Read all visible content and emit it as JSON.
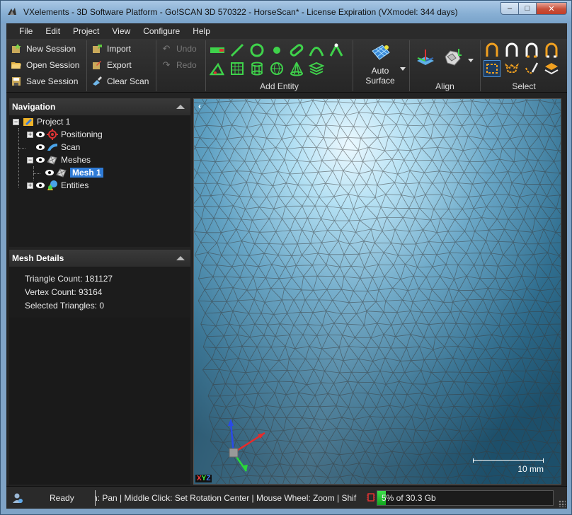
{
  "window": {
    "title": "VXelements - 3D Software Platform - Go!SCAN 3D 570322 - HorseScan* - License Expiration (VXmodel: 344 days)",
    "controls": {
      "minimize": "–",
      "maximize": "□",
      "close": "✕"
    }
  },
  "menu": [
    "File",
    "Edit",
    "Project",
    "View",
    "Configure",
    "Help"
  ],
  "ribbon": {
    "session": {
      "new": "New Session",
      "open": "Open Session",
      "save": "Save Session"
    },
    "io": {
      "import": "Import",
      "export": "Export",
      "clear": "Clear Scan"
    },
    "history": {
      "undo": "Undo",
      "redo": "Redo"
    },
    "add_entity": {
      "title": "Add Entity"
    },
    "auto_surface": {
      "line1": "Auto",
      "line2": "Surface"
    },
    "align": {
      "title": "Align"
    },
    "select": {
      "title": "Select"
    }
  },
  "navigation": {
    "title": "Navigation",
    "project": "Project 1",
    "positioning": "Positioning",
    "scan": "Scan",
    "meshes": "Meshes",
    "mesh": "Mesh 1",
    "entities": "Entities"
  },
  "mesh_details": {
    "title": "Mesh Details",
    "triangle_count": "Triangle Count: 181127",
    "vertex_count": "Vertex Count: 93164",
    "selected": "Selected Triangles: 0"
  },
  "viewport": {
    "collapse": "‹",
    "scale_label": "10 mm",
    "axes": {
      "x": "X",
      "y": "Y",
      "z": "Z"
    }
  },
  "status": {
    "ready": "Ready",
    "hint": "n: Pan  |  Middle Click: Set Rotation Center  |  Mouse Wheel: Zoom  |  Shif",
    "memory": "5% of 30.3 Gb",
    "memory_fraction": 0.05
  },
  "colors": {
    "accent": "#2f7bd6",
    "mesh_dark": "#1f5470",
    "mesh_light": "#dff4ff",
    "mem_fill": "#2fd23d"
  }
}
